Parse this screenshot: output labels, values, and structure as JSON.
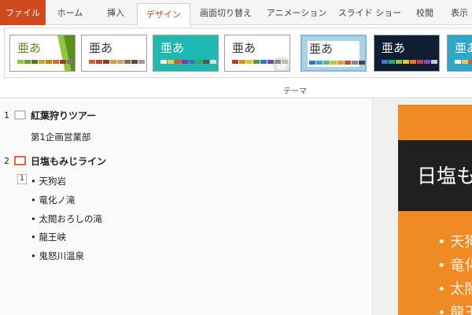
{
  "ribbon": {
    "tabs": [
      {
        "label": "ファイル",
        "name": "tab-file"
      },
      {
        "label": "ホーム",
        "name": "tab-home"
      },
      {
        "label": "挿入",
        "name": "tab-insert"
      },
      {
        "label": "デザイン",
        "name": "tab-design"
      },
      {
        "label": "画面切り替え",
        "name": "tab-transitions"
      },
      {
        "label": "アニメーション",
        "name": "tab-animations"
      },
      {
        "label": "スライド ショー",
        "name": "tab-slideshow"
      },
      {
        "label": "校閲",
        "name": "tab-review"
      },
      {
        "label": "表示",
        "name": "tab-view"
      }
    ],
    "active_tab": "デザイン",
    "group_label": "テーマ",
    "themes": [
      {
        "label": "亜あ",
        "bg": "#ffffff",
        "text_color": "#5a8a2a",
        "swatches": [
          "#8dc63f",
          "#6a9f2e",
          "#4f7a22",
          "#c8a13a",
          "#b8860b",
          "#d36b2b",
          "#9c3d26",
          "#777777"
        ]
      },
      {
        "label": "亜あ",
        "bg": "#ffffff",
        "text_color": "#333333",
        "swatches": [
          "#d65a2a",
          "#b8462a",
          "#8c3a28",
          "#d99a40",
          "#c7a26a",
          "#8a6a4a",
          "#5a4a3a",
          "#999999"
        ]
      },
      {
        "label": "亜あ",
        "bg": "#1fb8b0",
        "text_color": "#ffffff",
        "swatches": [
          "#ffffff",
          "#f2c94c",
          "#e0533a",
          "#8a3b8f",
          "#2a7ab8",
          "#3aa35a",
          "#555555",
          "#dddddd"
        ]
      },
      {
        "label": "亜あ",
        "bg": "#ffffff",
        "text_color": "#333333",
        "swatches": [
          "#c0392b",
          "#d98a2b",
          "#e8c33a",
          "#4a9a4a",
          "#2a7ab8",
          "#6a4aa8",
          "#888888",
          "#bbbbbb"
        ]
      },
      {
        "label": "亜あ",
        "bg": "#a9d4e6",
        "text_color": "#333333",
        "swatches": [
          "#2a7ab8",
          "#3aa5c8",
          "#5ab88a",
          "#b8c83a",
          "#e09a3a",
          "#c0532a",
          "#888888",
          "#444444"
        ]
      },
      {
        "label": "亜あ",
        "bg": "#0f1e33",
        "text_color": "#ffffff",
        "swatches": [
          "#3a7ac8",
          "#2aa58a",
          "#8ac83a",
          "#e8c33a",
          "#e07a2a",
          "#c83a5a",
          "#8a4ac8",
          "#cccccc"
        ]
      },
      {
        "label": "亜あ",
        "bg": "#2fa7c9",
        "text_color": "#ffffff",
        "swatches": [
          "#ffffff",
          "#f2c94c",
          "#e0533a",
          "#3aa35a",
          "#2a7ab8",
          "#8a3b8f",
          "#777777",
          "#dddddd"
        ]
      }
    ]
  },
  "outline": {
    "slides": [
      {
        "number": "1",
        "title": "紅葉狩りツアー",
        "lines": [
          "第1企画営業部"
        ]
      },
      {
        "number": "2",
        "title": "日塩もみじライン",
        "level_marker": "1",
        "bullets": [
          "• 天狗岩",
          "• 竜化ノ滝",
          "• 太閤おろしの滝",
          "• 龍王峡",
          "• 鬼怒川温泉"
        ]
      }
    ]
  },
  "preview": {
    "title": "日塩もみじライン",
    "bullets": [
      "• 天狗岩",
      "• 竜化ノ滝",
      "• 太閤おろしの滝",
      "• 龍王峡"
    ],
    "slide_color": "#f08a24",
    "band_color": "#202020"
  }
}
